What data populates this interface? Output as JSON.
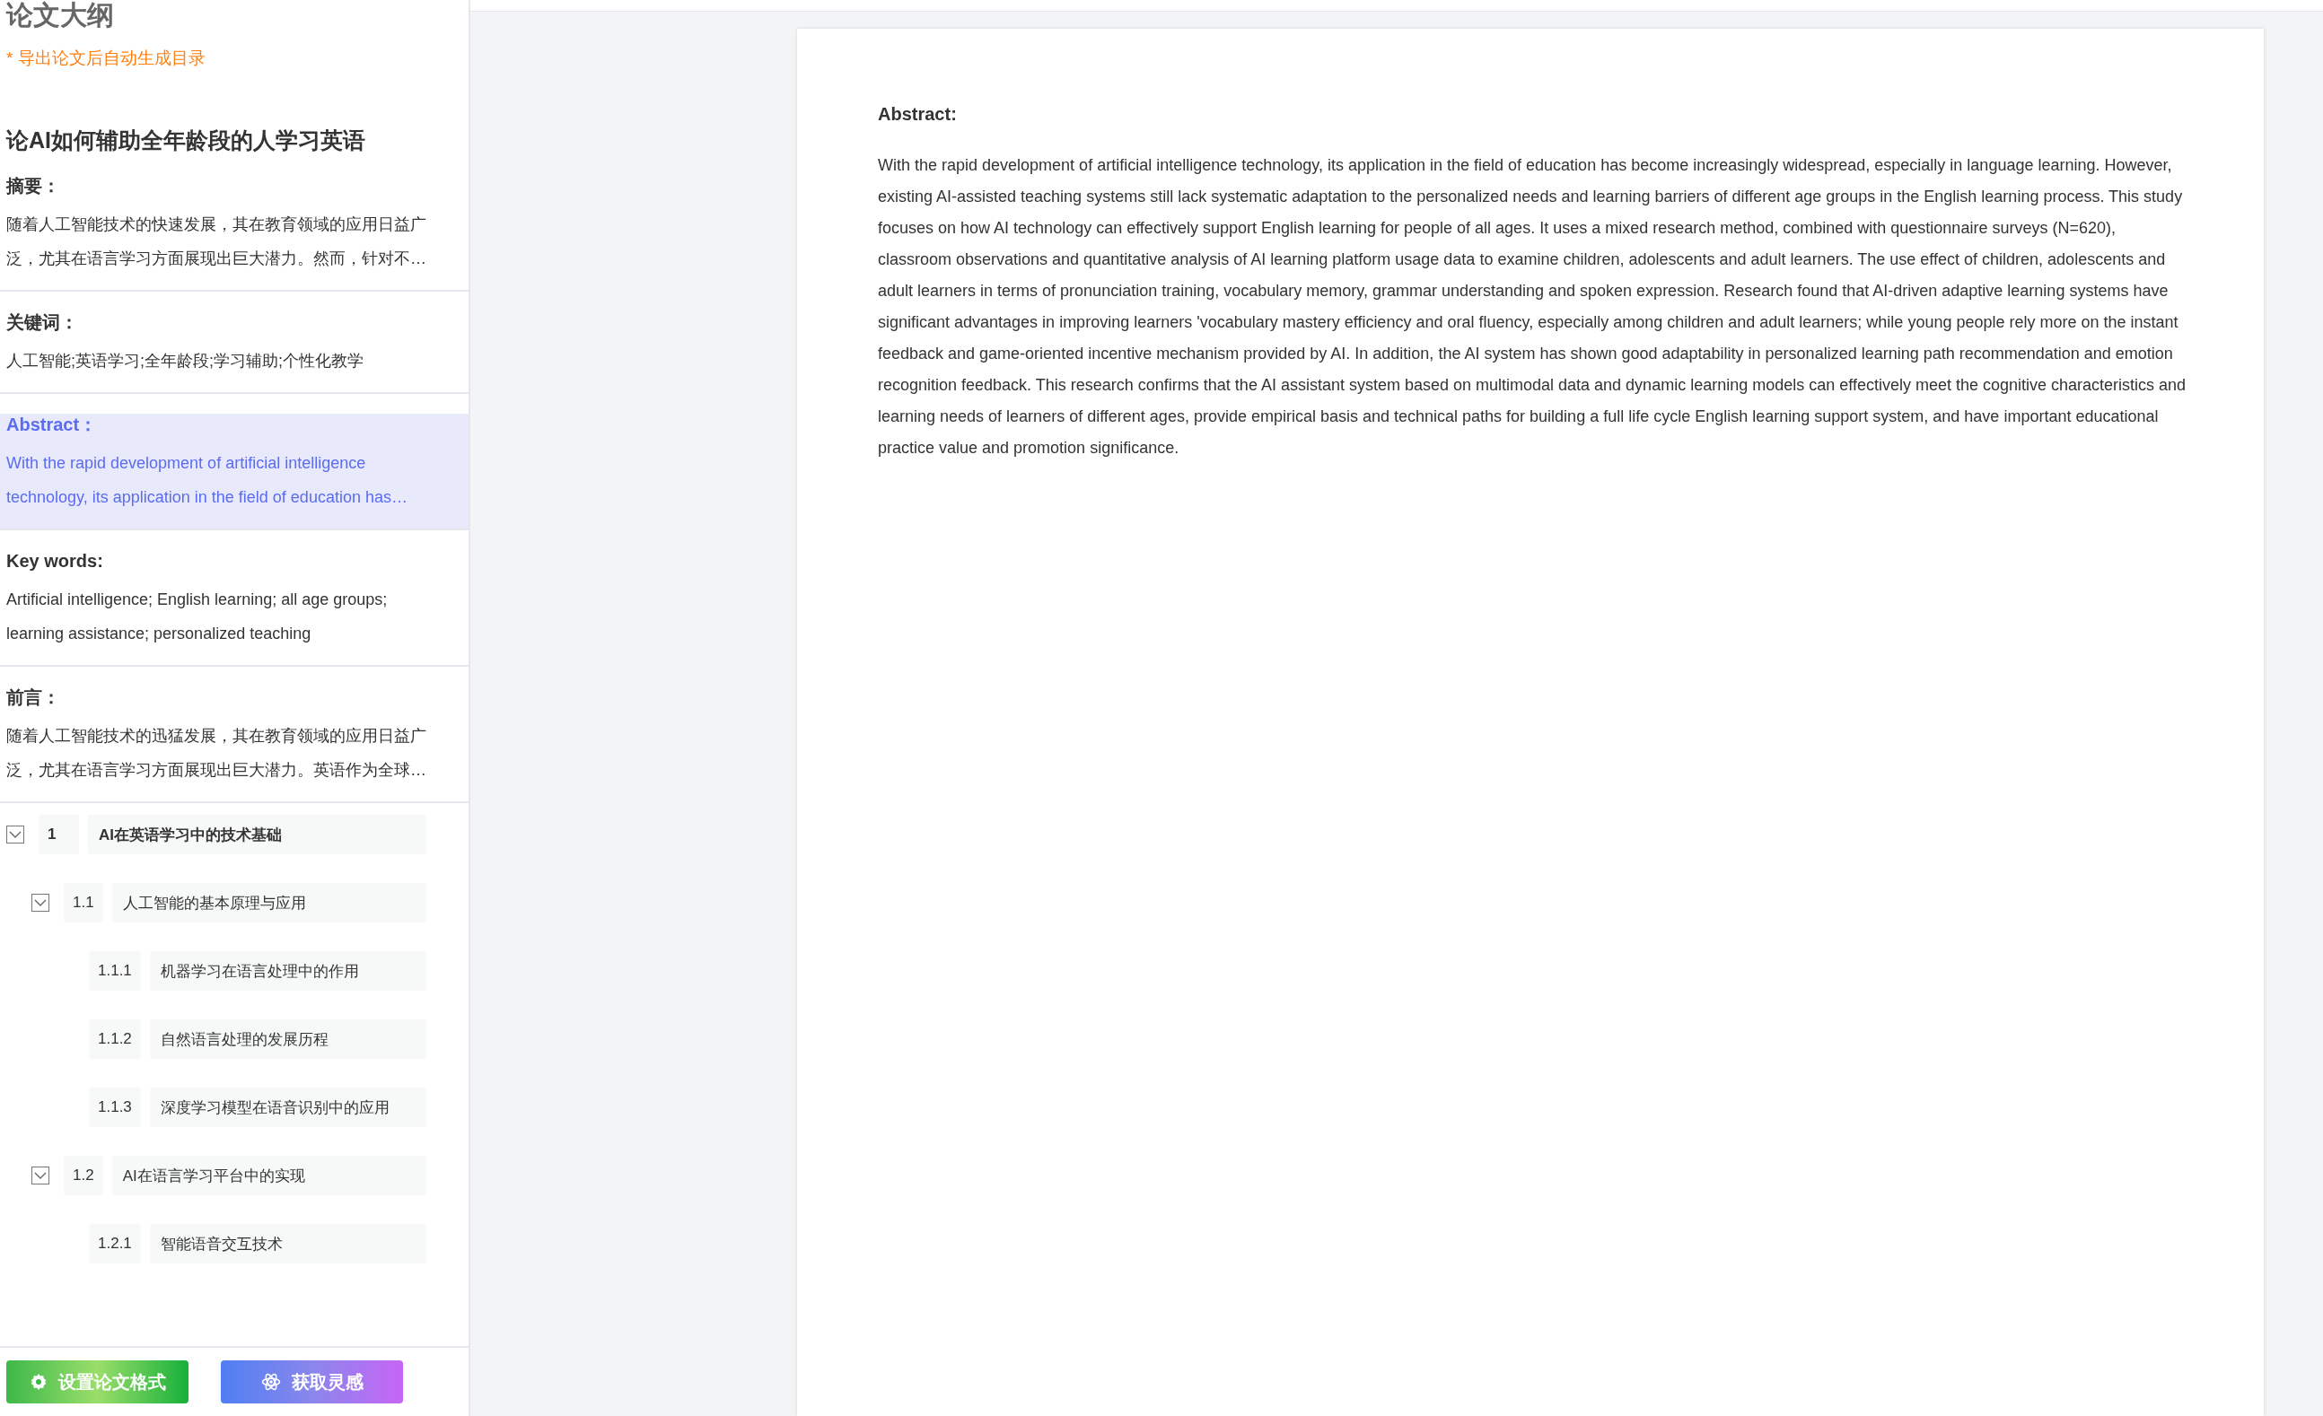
{
  "sidebar": {
    "title": "论文大纲",
    "note": "* 导出论文后自动生成目录",
    "paper_title": "论AI如何辅助全年龄段的人学习英语",
    "sections": [
      {
        "heading": "摘要：",
        "text": "随着人工智能技术的快速发展，其在教育领域的应用日益广泛，尤其在语言学习方面展现出巨大潜力。然而，针对不…",
        "selected": false
      },
      {
        "heading": "关键词：",
        "text": "人工智能;英语学习;全年龄段;学习辅助;个性化教学",
        "selected": false
      },
      {
        "heading": "Abstract：",
        "text": "With the rapid development of artificial intelligence technology, its application in the field of education has…",
        "selected": true
      },
      {
        "heading": "Key words:",
        "text": "Artificial intelligence; English learning; all age groups; learning assistance; personalized teaching",
        "selected": false
      },
      {
        "heading": "前言：",
        "text": "随着人工智能技术的迅猛发展，其在教育领域的应用日益广泛，尤其在语言学习方面展现出巨大潜力。英语作为全球…",
        "selected": false
      }
    ],
    "outline": [
      {
        "number": "1",
        "title": "AI在英语学习中的技术基础",
        "expanded": true,
        "children": [
          {
            "number": "1.1",
            "title": "人工智能的基本原理与应用",
            "expanded": true,
            "children": [
              {
                "number": "1.1.1",
                "title": "机器学习在语言处理中的作用"
              },
              {
                "number": "1.1.2",
                "title": "自然语言处理的发展历程"
              },
              {
                "number": "1.1.3",
                "title": "深度学习模型在语音识别中的应用"
              }
            ]
          },
          {
            "number": "1.2",
            "title": "AI在语言学习平台中的实现",
            "expanded": true,
            "children": [
              {
                "number": "1.2.1",
                "title": "智能语音交互技术"
              }
            ]
          }
        ]
      }
    ],
    "buttons": [
      {
        "kind": "format",
        "label": "设置论文格式"
      },
      {
        "kind": "inspire",
        "label": "获取灵感"
      }
    ]
  },
  "document": {
    "heading": "Abstract:",
    "body": "With the rapid development of artificial intelligence technology, its application in the field of education has become increasingly widespread, especially in language learning. However, existing AI-assisted teaching systems still lack systematic adaptation to the personalized needs and learning barriers of different age groups in the English learning process. This study focuses on how AI technology can effectively support English learning for people of all ages. It uses a mixed research method, combined with questionnaire surveys (N=620), classroom observations and quantitative analysis of AI learning platform usage data to examine children, adolescents and adult learners. The use effect of children, adolescents and adult learners in terms of pronunciation training, vocabulary memory, grammar understanding and spoken expression. Research found that AI-driven adaptive learning systems have significant advantages in improving learners 'vocabulary mastery efficiency and oral fluency, especially among children and adult learners; while young people rely more on the instant feedback and game-oriented incentive mechanism provided by AI. In addition, the AI system has shown good adaptability in personalized learning path recommendation and emotion recognition feedback. This research confirms that the AI assistant system based on multimodal data and dynamic learning models can effectively meet the cognitive characteristics and learning needs of learners of different ages, provide empirical basis and technical paths for building a full life cycle English learning support system, and have important educational practice value and promotion significance."
  }
}
